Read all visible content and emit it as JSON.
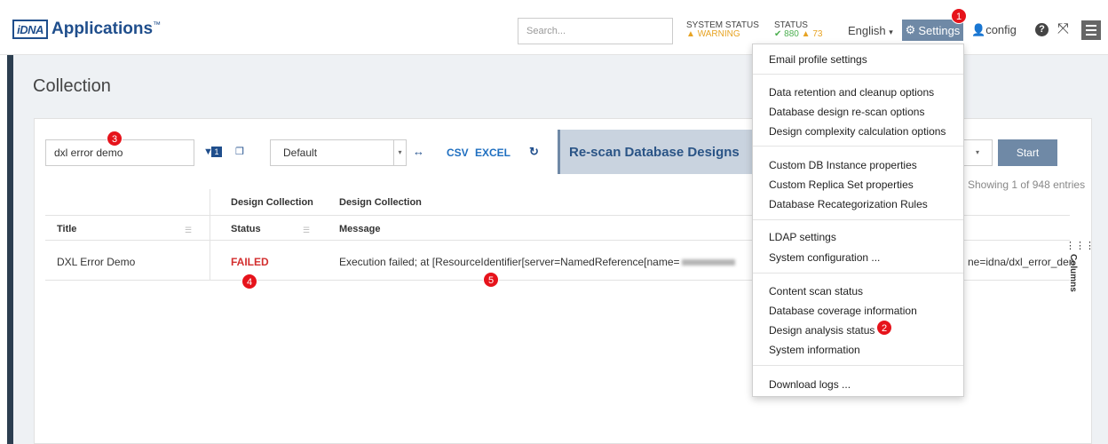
{
  "header": {
    "logo_mark": "iDNA",
    "logo_text": "Applications",
    "logo_tm": "™",
    "search_placeholder": "Search...",
    "system_status_label": "SYSTEM STATUS",
    "system_status_value": "WARNING",
    "status_label": "STATUS",
    "status_ok_count": "880",
    "status_warn_count": "73",
    "language": "English",
    "settings_label": "Settings",
    "user_label": "config"
  },
  "page": {
    "title": "Collection"
  },
  "toolbar": {
    "filter_value": "dxl error demo",
    "filter_count": "1",
    "view_select": "Default",
    "csv_label": "CSV",
    "excel_label": "EXCEL",
    "rescan_title": "Re-scan Database Designs",
    "start_label": "Start",
    "showing": "Showing 1 of 948 entries"
  },
  "table": {
    "group_headers": [
      "Design Collection",
      "Design Collection"
    ],
    "headers": [
      "Title",
      "Status",
      "Message"
    ],
    "rows": [
      {
        "title": "DXL Error Demo",
        "status": "FAILED",
        "message": "Execution failed; at [ResourceIdentifier[server=NamedReference[name=",
        "message_tail": "ne=idna/dxl_error_den"
      }
    ],
    "columns_label": "Columns"
  },
  "dropdown": {
    "groups": [
      [
        "Email profile settings"
      ],
      [
        "Data retention and cleanup options",
        "Database design re-scan options",
        "Design complexity calculation options"
      ],
      [
        "Custom DB Instance properties",
        "Custom Replica Set properties",
        "Database Recategorization Rules"
      ],
      [
        "LDAP settings",
        "System configuration ..."
      ],
      [
        "Content scan status",
        "Database coverage information",
        "Design analysis status",
        "System information"
      ],
      [
        "Download logs ..."
      ]
    ]
  },
  "annotations": [
    "1",
    "2",
    "3",
    "4",
    "5"
  ],
  "colors": {
    "brand": "#1f4e8c",
    "accent": "#6f89a6",
    "failed": "#d32f2f",
    "warning": "#e7a323",
    "ok": "#4caf50",
    "badge": "#e6131b"
  }
}
